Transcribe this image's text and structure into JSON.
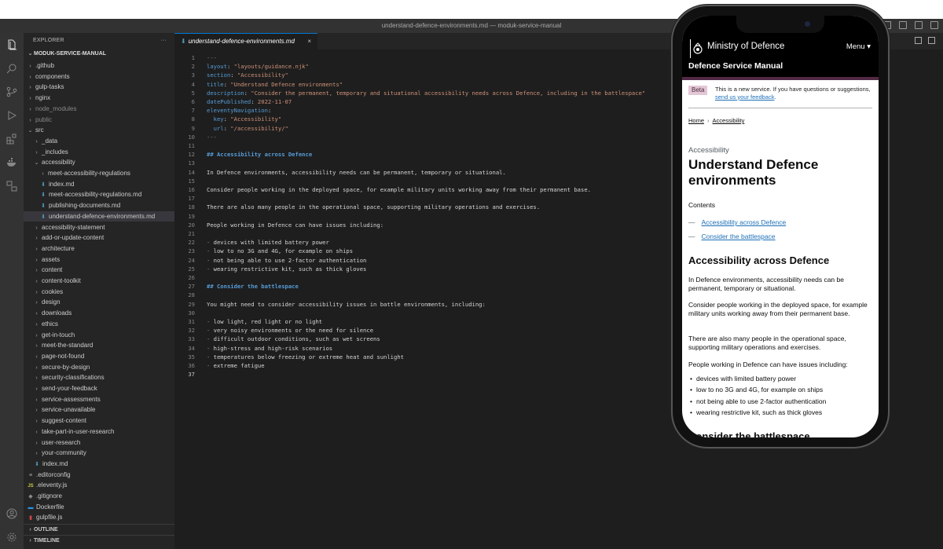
{
  "window": {
    "title": "understand-defence-environments.md — moduk-service-manual"
  },
  "explorer": {
    "header": "EXPLORER",
    "more": "···",
    "root": "MODUK-SERVICE-MANUAL",
    "items": [
      {
        "label": ".github",
        "depth": 1,
        "type": "folder",
        "open": false,
        "dim": false
      },
      {
        "label": "components",
        "depth": 1,
        "type": "folder",
        "open": false,
        "dim": false
      },
      {
        "label": "gulp-tasks",
        "depth": 1,
        "type": "folder",
        "open": false,
        "dim": false
      },
      {
        "label": "nginx",
        "depth": 1,
        "type": "folder",
        "open": false,
        "dim": false
      },
      {
        "label": "node_modules",
        "depth": 1,
        "type": "folder",
        "open": false,
        "dim": true
      },
      {
        "label": "public",
        "depth": 1,
        "type": "folder",
        "open": false,
        "dim": true
      },
      {
        "label": "src",
        "depth": 1,
        "type": "folder",
        "open": true,
        "dim": false
      },
      {
        "label": "_data",
        "depth": 2,
        "type": "folder",
        "open": false,
        "dim": false
      },
      {
        "label": "_includes",
        "depth": 2,
        "type": "folder",
        "open": false,
        "dim": false
      },
      {
        "label": "accessibility",
        "depth": 2,
        "type": "folder",
        "open": true,
        "dim": false
      },
      {
        "label": "meet-accessibility-regulations",
        "depth": 3,
        "type": "folder",
        "open": false,
        "dim": false
      },
      {
        "label": "index.md",
        "depth": 3,
        "type": "md",
        "dim": false
      },
      {
        "label": "meet-accessibility-regulations.md",
        "depth": 3,
        "type": "md",
        "dim": false
      },
      {
        "label": "publishing-documents.md",
        "depth": 3,
        "type": "md",
        "dim": false
      },
      {
        "label": "understand-defence-environments.md",
        "depth": 3,
        "type": "md",
        "dim": false,
        "active": true
      },
      {
        "label": "accessibility-statement",
        "depth": 2,
        "type": "folder",
        "open": false,
        "dim": false
      },
      {
        "label": "add-or-update-content",
        "depth": 2,
        "type": "folder",
        "open": false,
        "dim": false
      },
      {
        "label": "architecture",
        "depth": 2,
        "type": "folder",
        "open": false,
        "dim": false
      },
      {
        "label": "assets",
        "depth": 2,
        "type": "folder",
        "open": false,
        "dim": false
      },
      {
        "label": "content",
        "depth": 2,
        "type": "folder",
        "open": false,
        "dim": false
      },
      {
        "label": "content-toolkit",
        "depth": 2,
        "type": "folder",
        "open": false,
        "dim": false
      },
      {
        "label": "cookies",
        "depth": 2,
        "type": "folder",
        "open": false,
        "dim": false
      },
      {
        "label": "design",
        "depth": 2,
        "type": "folder",
        "open": false,
        "dim": false
      },
      {
        "label": "downloads",
        "depth": 2,
        "type": "folder",
        "open": false,
        "dim": false
      },
      {
        "label": "ethics",
        "depth": 2,
        "type": "folder",
        "open": false,
        "dim": false
      },
      {
        "label": "get-in-touch",
        "depth": 2,
        "type": "folder",
        "open": false,
        "dim": false
      },
      {
        "label": "meet-the-standard",
        "depth": 2,
        "type": "folder",
        "open": false,
        "dim": false
      },
      {
        "label": "page-not-found",
        "depth": 2,
        "type": "folder",
        "open": false,
        "dim": false
      },
      {
        "label": "secure-by-design",
        "depth": 2,
        "type": "folder",
        "open": false,
        "dim": false
      },
      {
        "label": "security-classifications",
        "depth": 2,
        "type": "folder",
        "open": false,
        "dim": false
      },
      {
        "label": "send-your-feedback",
        "depth": 2,
        "type": "folder",
        "open": false,
        "dim": false
      },
      {
        "label": "service-assessments",
        "depth": 2,
        "type": "folder",
        "open": false,
        "dim": false
      },
      {
        "label": "service-unavailable",
        "depth": 2,
        "type": "folder",
        "open": false,
        "dim": false
      },
      {
        "label": "suggest-content",
        "depth": 2,
        "type": "folder",
        "open": false,
        "dim": false
      },
      {
        "label": "take-part-in-user-research",
        "depth": 2,
        "type": "folder",
        "open": false,
        "dim": false
      },
      {
        "label": "user-research",
        "depth": 2,
        "type": "folder",
        "open": false,
        "dim": false
      },
      {
        "label": "your-community",
        "depth": 2,
        "type": "folder",
        "open": false,
        "dim": false
      },
      {
        "label": "index.md",
        "depth": 2,
        "type": "md",
        "dim": false
      },
      {
        "label": ".editorconfig",
        "depth": 1,
        "type": "cfg",
        "dim": false
      },
      {
        "label": ".eleventy.js",
        "depth": 1,
        "type": "js",
        "dim": false
      },
      {
        "label": ".gitignore",
        "depth": 1,
        "type": "git",
        "dim": false
      },
      {
        "label": "Dockerfile",
        "depth": 1,
        "type": "docker",
        "dim": false
      },
      {
        "label": "gulpfile.js",
        "depth": 1,
        "type": "gulp",
        "dim": false
      }
    ],
    "outline": "OUTLINE",
    "timeline": "TIMELINE"
  },
  "editor": {
    "tab_label": "understand-defence-environments.md",
    "tab_close": "×",
    "current_line": 37,
    "lines": [
      [
        [
          "g",
          "---"
        ]
      ],
      [
        [
          "k",
          "layout"
        ],
        [
          "t",
          ": "
        ],
        [
          "s",
          "\"layouts/guidance.njk\""
        ]
      ],
      [
        [
          "k",
          "section"
        ],
        [
          "t",
          ": "
        ],
        [
          "s",
          "\"Accessibility\""
        ]
      ],
      [
        [
          "k",
          "title"
        ],
        [
          "t",
          ": "
        ],
        [
          "s",
          "\"Understand Defence environments\""
        ]
      ],
      [
        [
          "k",
          "description"
        ],
        [
          "t",
          ": "
        ],
        [
          "s",
          "\"Consider the permanent, temporary and situational accessibility needs across Defence, including in the battlespace\""
        ]
      ],
      [
        [
          "k",
          "datePublished"
        ],
        [
          "t",
          ": "
        ],
        [
          "s",
          "2022-11-07"
        ]
      ],
      [
        [
          "k",
          "eleventyNavigation"
        ],
        [
          "t",
          ":"
        ]
      ],
      [
        [
          "t",
          "  "
        ],
        [
          "k",
          "key"
        ],
        [
          "t",
          ": "
        ],
        [
          "s",
          "\"Accessibility\""
        ]
      ],
      [
        [
          "t",
          "  "
        ],
        [
          "k",
          "url"
        ],
        [
          "t",
          ": "
        ],
        [
          "s",
          "\"/accessibility/\""
        ]
      ],
      [
        [
          "g",
          "---"
        ]
      ],
      [],
      [
        [
          "h",
          "## Accessibility across Defence"
        ]
      ],
      [],
      [
        [
          "t",
          "In Defence environments, accessibility needs can be permanent, temporary or situational."
        ]
      ],
      [],
      [
        [
          "t",
          "Consider people working in the deployed space, for example military units working away from their permanent base."
        ]
      ],
      [],
      [
        [
          "t",
          "There are also many people in the operational space, supporting military operations and exercises."
        ]
      ],
      [],
      [
        [
          "t",
          "People working in Defence can have issues including:"
        ]
      ],
      [],
      [
        [
          "k",
          "-"
        ],
        [
          "t",
          " devices with limited battery power"
        ]
      ],
      [
        [
          "k",
          "-"
        ],
        [
          "t",
          " low to no 3G and 4G, for example on ships"
        ]
      ],
      [
        [
          "k",
          "-"
        ],
        [
          "t",
          " not being able to use 2-factor authentication"
        ]
      ],
      [
        [
          "k",
          "-"
        ],
        [
          "t",
          " wearing restrictive kit, such as thick gloves"
        ]
      ],
      [],
      [
        [
          "h",
          "## Consider the battlespace"
        ]
      ],
      [],
      [
        [
          "t",
          "You might need to consider accessibility issues in battle environments, including:"
        ]
      ],
      [],
      [
        [
          "k",
          "-"
        ],
        [
          "t",
          " low light, red light or no light"
        ]
      ],
      [
        [
          "k",
          "-"
        ],
        [
          "t",
          " very noisy environments or the need for silence"
        ]
      ],
      [
        [
          "k",
          "-"
        ],
        [
          "t",
          " difficult outdoor conditions, such as wet screens"
        ]
      ],
      [
        [
          "k",
          "-"
        ],
        [
          "t",
          " high-stress and high-risk scenarios"
        ]
      ],
      [
        [
          "k",
          "-"
        ],
        [
          "t",
          " temperatures below freezing or extreme heat and sunlight"
        ]
      ],
      [
        [
          "k",
          "-"
        ],
        [
          "t",
          " extreme fatigue"
        ]
      ],
      []
    ]
  },
  "preview": {
    "org_name": "Ministry of Defence",
    "menu": "Menu ▾",
    "service_name": "Defence Service Manual",
    "beta_tag": "Beta",
    "beta_text": "This is a new service. If you have questions or suggestions, ",
    "beta_link": "send us your feedback",
    "beta_end": ".",
    "breadcrumb_home": "Home",
    "breadcrumb_sep": "›",
    "breadcrumb_section": "Accessibility",
    "caption": "Accessibility",
    "title": "Understand Defence environments",
    "contents_label": "Contents",
    "contents": [
      "Accessibility across Defence",
      "Consider the battlespace"
    ],
    "h2_1": "Accessibility across Defence",
    "p1": "In Defence environments, accessibility needs can be permanent, temporary or situational.",
    "p2": "Consider people working in the deployed space, for example military units working away from their permanent base.",
    "p3": "There are also many people in the operational space, supporting military operations and exercises.",
    "p4": "People working in Defence can have issues including:",
    "bullets": [
      "devices with limited battery power",
      "low to no 3G and 4G, for example on ships",
      "not being able to use 2-factor authentication",
      "wearing restrictive kit, such as thick gloves"
    ],
    "h2_2": "Consider the battlespace"
  }
}
